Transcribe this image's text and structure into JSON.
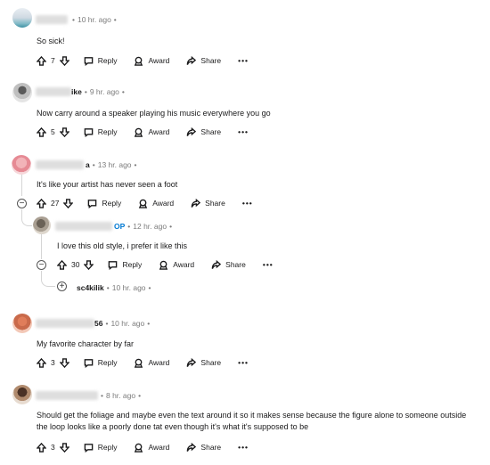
{
  "actions": {
    "reply": "Reply",
    "award": "Award",
    "share": "Share",
    "more": "•••"
  },
  "comments": [
    {
      "time": "10 hr. ago",
      "text": "So sick!",
      "votes": "7"
    },
    {
      "author": "ike",
      "time": "9 hr. ago",
      "text": "Now carry around a speaker playing his music everywhere you go",
      "votes": "5"
    },
    {
      "author": "a",
      "time": "13 hr. ago",
      "text": "It's like your artist has never seen a foot",
      "votes": "27"
    },
    {
      "author": "OP",
      "time": "12 hr. ago",
      "text": "I love this old style, i prefer it like this",
      "votes": "30"
    },
    {
      "author": "sc4kilik",
      "time": "10 hr. ago",
      "expand": "+"
    },
    {
      "author": "56",
      "time": "10 hr. ago",
      "text": "My favorite character by far",
      "votes": "3"
    },
    {
      "time": "8 hr. ago",
      "text": "Should get the foliage and maybe even the text around it so it makes sense because the figure alone to someone outside the loop looks like a poorly done tat even though it's what it's supposed to be",
      "votes": "3"
    }
  ],
  "colors": {
    "op": "#0079d3",
    "text": "#1a1a1b",
    "meta": "#7c7c7c",
    "thread": "#d5d5d5"
  }
}
